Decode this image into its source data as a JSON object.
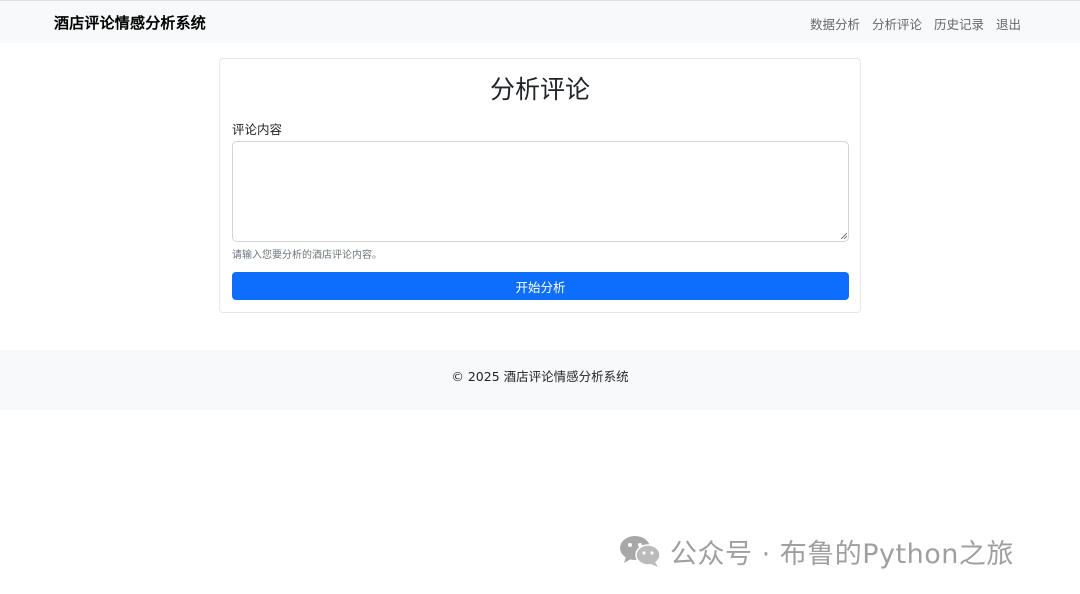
{
  "navbar": {
    "brand": "酒店评论情感分析系统",
    "links": [
      {
        "label": "数据分析"
      },
      {
        "label": "分析评论"
      },
      {
        "label": "历史记录"
      },
      {
        "label": "退出"
      }
    ]
  },
  "card": {
    "title": "分析评论",
    "field_label": "评论内容",
    "textarea_value": "",
    "help_text": "请输入您要分析的酒店评论内容。",
    "submit_label": "开始分析"
  },
  "footer": {
    "text": "© 2025 酒店评论情感分析系统"
  },
  "watermark": {
    "text": "公众号 · 布鲁的Python之旅",
    "icon": "wechat-icon"
  },
  "colors": {
    "primary": "#0d6efd",
    "navbar_bg": "#f8f9fa",
    "footer_bg": "#f8f9fa",
    "muted": "#6c757d"
  }
}
